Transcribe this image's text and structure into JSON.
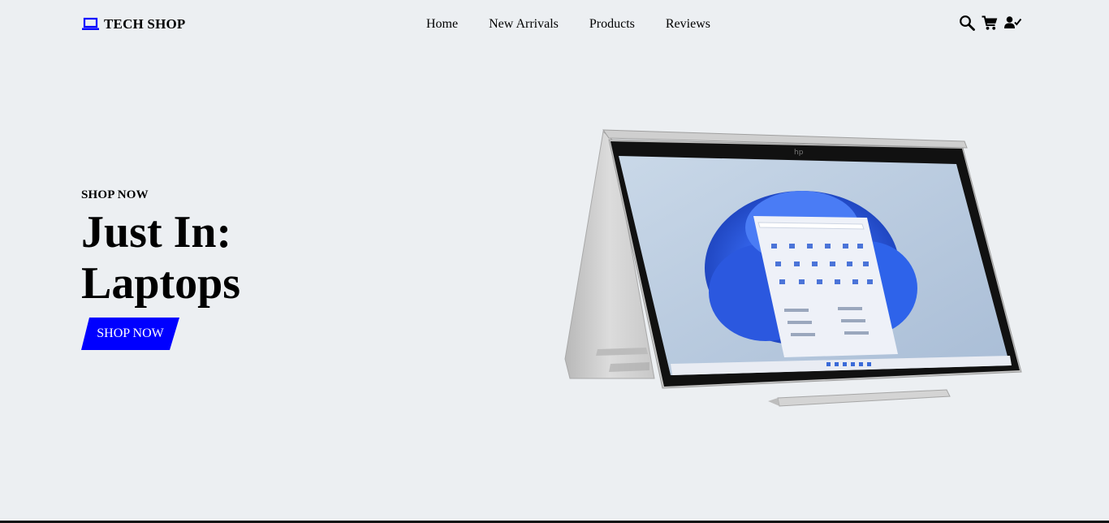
{
  "brand": {
    "name": "TECH SHOP",
    "icon": "laptop-icon",
    "accent": "#0000ff"
  },
  "nav": {
    "items": [
      {
        "label": "Home"
      },
      {
        "label": "New Arrivals"
      },
      {
        "label": "Products"
      },
      {
        "label": "Reviews"
      }
    ]
  },
  "header_icons": [
    "search-icon",
    "cart-icon",
    "user-check-icon"
  ],
  "hero": {
    "eyebrow": "SHOP NOW",
    "headline_line1": "Just In:",
    "headline_line2": "Laptops",
    "cta_label": "SHOP NOW",
    "cta_color": "#0000ff",
    "background": "#eceff2"
  }
}
